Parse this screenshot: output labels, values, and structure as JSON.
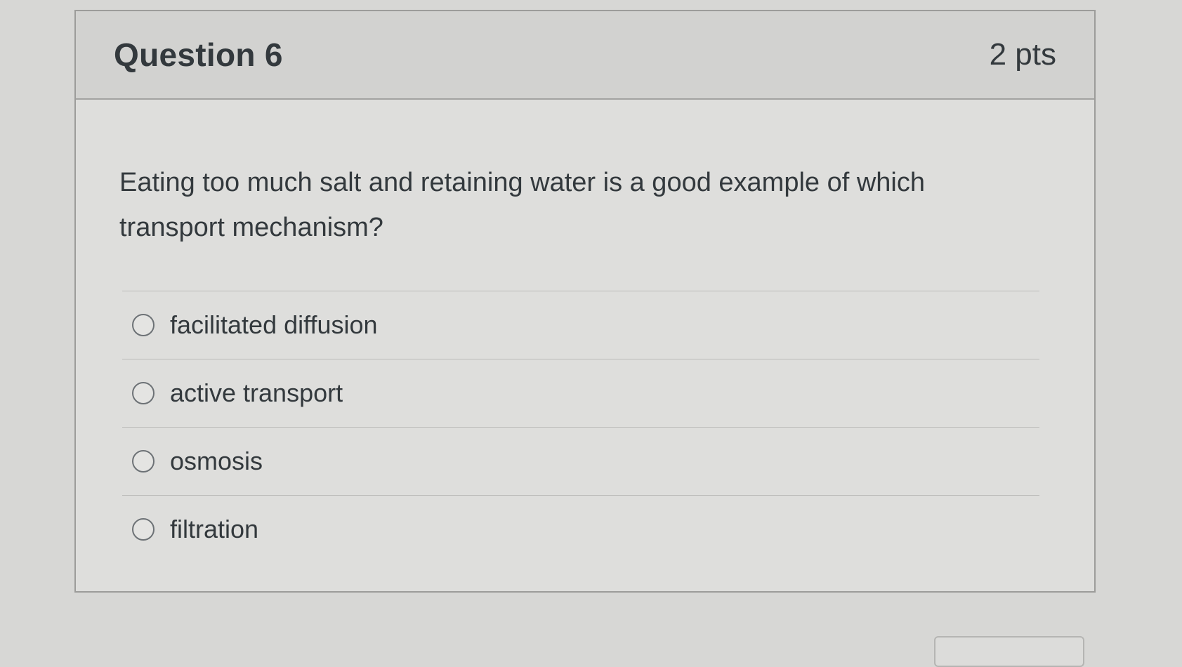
{
  "question": {
    "title": "Question 6",
    "points": "2 pts",
    "text": "Eating too much salt and retaining water is a good example of which transport mechanism?",
    "answers": [
      {
        "label": "facilitated diffusion"
      },
      {
        "label": "active transport"
      },
      {
        "label": "osmosis"
      },
      {
        "label": "filtration"
      }
    ]
  }
}
